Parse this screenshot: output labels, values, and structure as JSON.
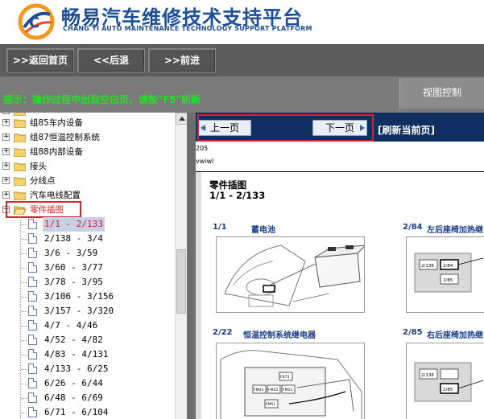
{
  "header": {
    "title_zh": "畅易汽车维修技术支持平台",
    "title_en": "CHANG YI AUTO MAINTENANCE TECHNOLOGY SUPPORT PLATFORM",
    "brand_color": "#1c4f95"
  },
  "nav": {
    "home_label": ">>返回首页",
    "back_label": "<<后退",
    "forward_label": ">>前进"
  },
  "hint": {
    "text": "提示：操作过程中出现空白页，请按\"F5\"刷新",
    "color": "#1fe51f"
  },
  "view_control": "视图控制",
  "tree": {
    "folders": [
      {
        "label": "组85车内设备",
        "icon": "folder-icon"
      },
      {
        "label": "组87恒温控制系统",
        "icon": "folder-icon"
      },
      {
        "label": "组88内部设备",
        "icon": "folder-icon"
      },
      {
        "label": "接头",
        "icon": "folder-icon"
      },
      {
        "label": "分线点",
        "icon": "folder-icon"
      },
      {
        "label": "汽车电线配置",
        "icon": "folder-icon"
      },
      {
        "label": "零件插图",
        "icon": "folder-open-icon",
        "expanded": true
      }
    ],
    "documents": [
      "1/1 - 2/133",
      "2/138 - 3/4",
      "3/6 - 3/59",
      "3/60 - 3/77",
      "3/78 - 3/95",
      "3/106 - 3/156",
      "3/157 - 3/320",
      "4/7 - 4/46",
      "4/52 - 4/82",
      "4/83 - 4/131",
      "4/133 - 6/25",
      "6/26 - 6/44",
      "6/48 - 6/69",
      "6/71 - 6/104"
    ],
    "selected_index": 0,
    "selected_color": "#e21a1a"
  },
  "viewer": {
    "prev_label": "上一页",
    "next_label": "下一页",
    "refresh_label": "[刷新当前页]",
    "meta_line1": "205",
    "meta_line2": "vwiwl",
    "sheet_title": "零件插图",
    "sheet_subtitle": "1/1 - 2/133",
    "figures": [
      {
        "no": "1/1",
        "name": "蓄电池"
      },
      {
        "no": "2/84",
        "name": "左后座椅加热继电器"
      },
      {
        "no": "2/22",
        "name": "恒温控制系统继电器"
      },
      {
        "no": "2/85",
        "name": "右后座椅加热继电器"
      }
    ],
    "relay_labels": [
      "2/136",
      "2/84",
      "2/85",
      "2/136",
      "2/85"
    ],
    "fuse_labels": [
      "F873",
      "FM43",
      "FM22",
      "FM25",
      "FM51"
    ]
  }
}
